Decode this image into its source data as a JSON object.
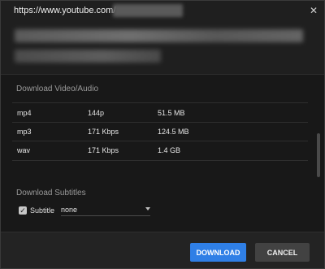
{
  "header": {
    "url_prefix": "https://www.youtube.com/",
    "close_icon": "close-icon"
  },
  "sections": {
    "download_title": "Download Video/Audio",
    "subtitles_title": "Download Subtitles"
  },
  "formats": [
    {
      "type": "mp4",
      "quality": "144p",
      "size": "51.5 MB"
    },
    {
      "type": "mp3",
      "quality": "171 Kbps",
      "size": "124.5 MB"
    },
    {
      "type": "wav",
      "quality": "171 Kbps",
      "size": "1.4 GB"
    }
  ],
  "subtitles": {
    "checkbox_label": "Subtitle",
    "checked": true,
    "selected": "none"
  },
  "footer": {
    "download_label": "DOWNLOAD",
    "cancel_label": "CANCEL"
  },
  "colors": {
    "accent": "#2f7fe6",
    "background": "#1d1d1d"
  }
}
